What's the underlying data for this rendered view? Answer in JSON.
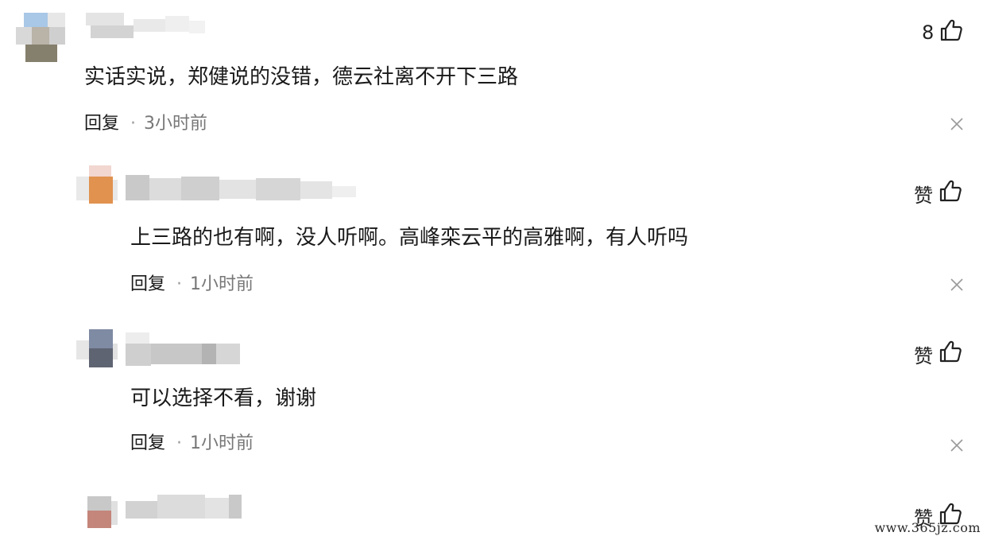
{
  "comments": [
    {
      "text": "实话实说，郑健说的没错，德云社离不开下三路",
      "reply_label": "回复",
      "separator": "·",
      "time": "3小时前",
      "like_count": "8"
    },
    {
      "text": "上三路的也有啊，没人听啊。高峰栾云平的高雅啊，有人听吗",
      "reply_label": "回复",
      "separator": "·",
      "time": "1小时前",
      "like_label": "赞"
    },
    {
      "text": "可以选择不看，谢谢",
      "reply_label": "回复",
      "separator": "·",
      "time": "1小时前",
      "like_label": "赞"
    },
    {
      "like_label": "赞"
    }
  ],
  "watermark": "www.365jz.com"
}
